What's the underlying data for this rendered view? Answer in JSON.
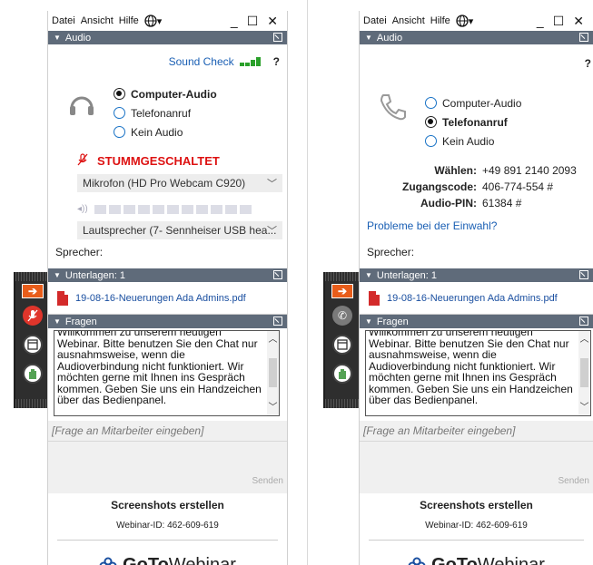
{
  "menu": {
    "datei": "Datei",
    "ansicht": "Ansicht",
    "hilfe": "Hilfe"
  },
  "window_controls": {
    "minimize": "_",
    "restore": "☐",
    "close": "✕"
  },
  "audio": {
    "header": "Audio",
    "sound_check": "Sound Check",
    "help": "?",
    "options": [
      "Computer-Audio",
      "Telefonanruf",
      "Kein Audio"
    ]
  },
  "left": {
    "selected_option": "Computer-Audio",
    "mute_label": "STUMMGESCHALTET",
    "mic_select": "Mikrofon (HD Pro Webcam C920)",
    "speaker_select": "Lautsprecher (7- Sennheiser USB hea...",
    "speaker_label": "Sprecher:"
  },
  "right": {
    "selected_option": "Telefonanruf",
    "dial_label": "Wählen:",
    "dial_value": "+49 891 2140 2093",
    "access_label": "Zugangscode:",
    "access_value": "406-774-554 #",
    "pin_label": "Audio-PIN:",
    "pin_value": "61384 #",
    "problem_link": "Probleme bei der Einwahl?",
    "speaker_label": "Sprecher:"
  },
  "documents": {
    "header": "Unterlagen: 1",
    "file": "19-08-16-Neuerungen Ada Admins.pdf"
  },
  "questions": {
    "header": "Fragen",
    "message": "Willkommen zu unserem heutigen Webinar. Bitte benutzen Sie den Chat nur ausnahmsweise, wenn die Audioverbindung nicht funktioniert. Wir möchten gerne mit Ihnen ins Gespräch kommen. Geben Sie uns ein Handzeichen über das Bedienpanel.",
    "input_placeholder": "[Frage an Mitarbeiter eingeben]",
    "send": "Senden"
  },
  "footer": {
    "screenshots": "Screenshots erstellen",
    "webinar_id": "Webinar-ID: 462-609-619",
    "logo_goto": "GoTo",
    "logo_webinar": "Webinar"
  },
  "colors": {
    "header_bar": "#5f6b7a",
    "mute_red": "#dd1111",
    "link_blue": "#1a5fb4",
    "sidebar_bg": "#2e2e2e",
    "arrow_orange": "#e85d1a"
  }
}
